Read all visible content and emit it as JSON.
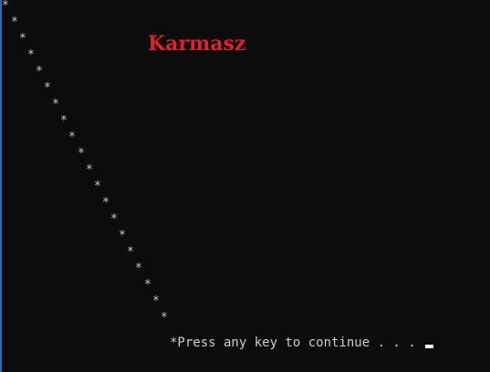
{
  "console": {
    "background_color": "#0c0c0c",
    "text_color": "#cccccc",
    "char": "*",
    "prompt": "*Press any key to continue . . . "
  },
  "watermark": {
    "text": "Karmasz",
    "color": "#e0202a"
  }
}
